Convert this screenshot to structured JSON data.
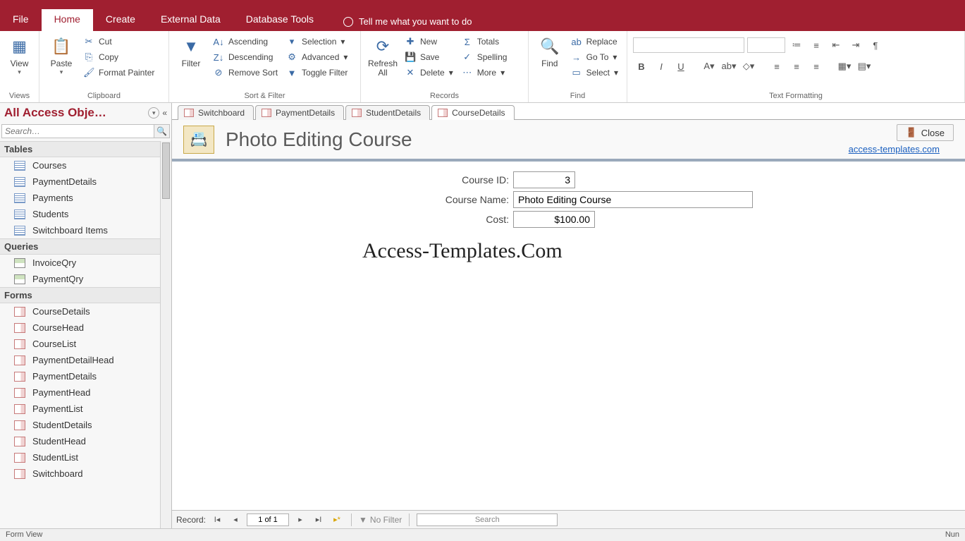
{
  "tabs": {
    "file": "File",
    "home": "Home",
    "create": "Create",
    "external": "External Data",
    "dbtools": "Database Tools",
    "tell": "Tell me what you want to do"
  },
  "ribbon": {
    "views": {
      "view": "View",
      "label": "Views"
    },
    "clipboard": {
      "paste": "Paste",
      "cut": "Cut",
      "copy": "Copy",
      "painter": "Format Painter",
      "label": "Clipboard"
    },
    "sortfilter": {
      "filter": "Filter",
      "asc": "Ascending",
      "desc": "Descending",
      "remove": "Remove Sort",
      "selection": "Selection",
      "advanced": "Advanced",
      "toggle": "Toggle Filter",
      "label": "Sort & Filter"
    },
    "records": {
      "refresh": "Refresh All",
      "new": "New",
      "save": "Save",
      "delete": "Delete",
      "totals": "Totals",
      "spelling": "Spelling",
      "more": "More",
      "label": "Records"
    },
    "find": {
      "find": "Find",
      "replace": "Replace",
      "goto": "Go To",
      "select": "Select",
      "label": "Find"
    },
    "fmt": {
      "label": "Text Formatting"
    }
  },
  "nav": {
    "title": "All Access Obje…",
    "search": "Search…",
    "cats": {
      "tables": "Tables",
      "queries": "Queries",
      "forms": "Forms"
    },
    "tables": [
      "Courses",
      "PaymentDetails",
      "Payments",
      "Students",
      "Switchboard Items"
    ],
    "queries": [
      "InvoiceQry",
      "PaymentQry"
    ],
    "forms": [
      "CourseDetails",
      "CourseHead",
      "CourseList",
      "PaymentDetailHead",
      "PaymentDetails",
      "PaymentHead",
      "PaymentList",
      "StudentDetails",
      "StudentHead",
      "StudentList",
      "Switchboard"
    ]
  },
  "doctabs": [
    "Switchboard",
    "PaymentDetails",
    "StudentDetails",
    "CourseDetails"
  ],
  "form": {
    "title": "Photo Editing Course",
    "close": "Close",
    "link": "access-templates.com",
    "fields": {
      "id_label": "Course ID:",
      "id_value": "3",
      "name_label": "Course Name:",
      "name_value": "Photo Editing Course",
      "cost_label": "Cost:",
      "cost_value": "$100.00"
    },
    "watermark": "Access-Templates.Com"
  },
  "recnav": {
    "label": "Record:",
    "pos": "1 of 1",
    "nofilter": "No Filter",
    "search": "Search"
  },
  "status": {
    "left": "Form View",
    "right": "Nun"
  }
}
